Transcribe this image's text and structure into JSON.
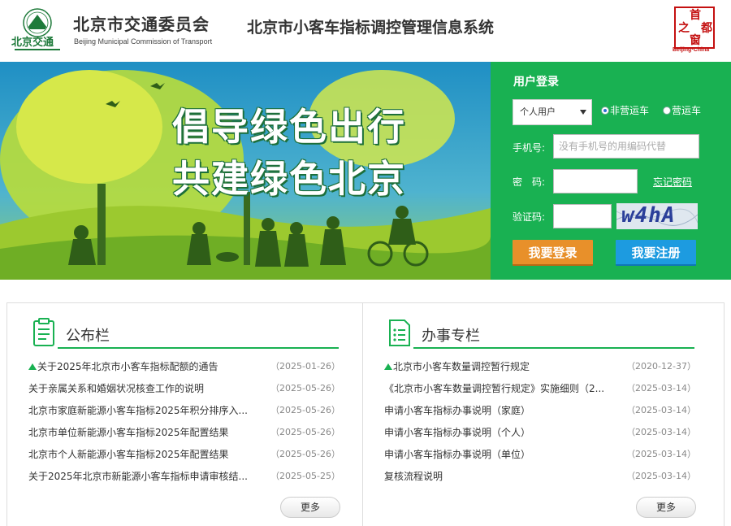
{
  "header": {
    "org_name_cn": "北京市交通委员会",
    "org_name_en": "Beijing Municipal Commission of Transport",
    "logo_text": "北京交通",
    "system_title": "北京市小客车指标调控管理信息系统",
    "capital_seal_chars": [
      "首",
      "都",
      "之",
      "窗"
    ],
    "capital_seal_en": "Beijing·China"
  },
  "banner": {
    "slogan_line1": "倡导绿色出行",
    "slogan_line2": "共建绿色北京"
  },
  "login": {
    "title": "用户登录",
    "user_type_selected": "个人用户",
    "radio_options": [
      "非营运车",
      "营运车"
    ],
    "radio_selected": "非营运车",
    "phone_label": "手机号:",
    "phone_placeholder": "没有手机号的用编码代替",
    "password_label": "密　码:",
    "forgot_link": "忘记密码",
    "captcha_label": "验证码:",
    "captcha_text": "w4hA",
    "login_button": "我要登录",
    "register_button": "我要注册"
  },
  "announcements": {
    "title": "公布栏",
    "more": "更多",
    "items": [
      {
        "title": "关于2025年北京市小客车指标配额的通告",
        "date": "（2025-01-26）",
        "pinned": true
      },
      {
        "title": "关于亲属关系和婚姻状况核查工作的说明",
        "date": "（2025-05-26）",
        "pinned": false
      },
      {
        "title": "北京市家庭新能源小客车指标2025年积分排序入...",
        "date": "（2025-05-26）",
        "pinned": false
      },
      {
        "title": "北京市单位新能源小客车指标2025年配置结果",
        "date": "（2025-05-26）",
        "pinned": false
      },
      {
        "title": "北京市个人新能源小客车指标2025年配置结果",
        "date": "（2025-05-26）",
        "pinned": false
      },
      {
        "title": "关于2025年北京市新能源小客车指标申请审核结...",
        "date": "（2025-05-25）",
        "pinned": false
      }
    ]
  },
  "services": {
    "title": "办事专栏",
    "more": "更多",
    "items": [
      {
        "title": "北京市小客车数量调控暂行规定",
        "date": "（2020-12-37）",
        "pinned": true
      },
      {
        "title": "《北京市小客车数量调控暂行规定》实施细则（2...",
        "date": "（2025-03-14）",
        "pinned": false
      },
      {
        "title": "申请小客车指标办事说明（家庭）",
        "date": "（2025-03-14）",
        "pinned": false
      },
      {
        "title": "申请小客车指标办事说明（个人）",
        "date": "（2025-03-14）",
        "pinned": false
      },
      {
        "title": "申请小客车指标办事说明（单位）",
        "date": "（2025-03-14）",
        "pinned": false
      },
      {
        "title": "复核流程说明",
        "date": "（2025-03-14）",
        "pinned": false
      }
    ]
  },
  "colors": {
    "brand_green": "#19b152",
    "login_orange": "#e8902a",
    "register_blue": "#1d9be0",
    "seal_red": "#c41010"
  }
}
